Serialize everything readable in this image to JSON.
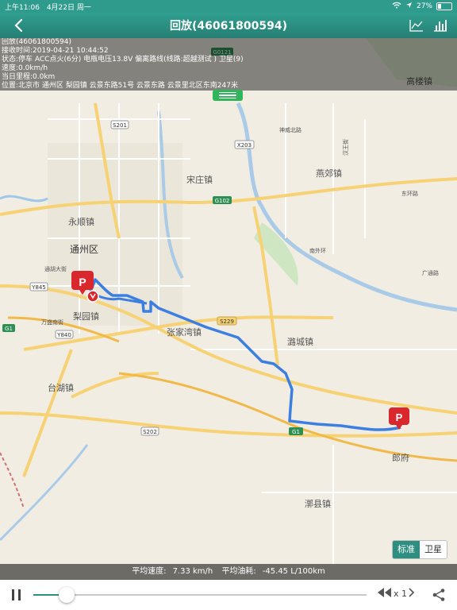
{
  "status_bar": {
    "time": "上午11:06",
    "date": "4月22日 周一",
    "battery": "27%"
  },
  "nav": {
    "title": "回放(46061800594)",
    "icons": [
      "back-chevron-icon",
      "line-chart-icon",
      "bar-chart-icon"
    ]
  },
  "info": {
    "line1": "回放(46061800594)",
    "line2": "接收时间:2019-04-21 10:44:52",
    "line3": "状态:停车  ACC点火(6分) 电瓶电压13.8V 偏离路线(线路:超越测试 ) 卫星(9)",
    "line4": "速度:0.0km/h",
    "line5": "当日里程:0.0km",
    "line6": "位置:北京市 通州区 梨园镇 云景东路51号 云景东路 云景里北区东南247米"
  },
  "map": {
    "labels": {
      "gaolouzhen": "高楼镇",
      "songzhuangzhen": "宋庄镇",
      "yanjiaozhen": "燕郊镇",
      "yongshunzhen": "永顺镇",
      "tongzhouqu": "通州区",
      "liyuanzhen": "梨园镇",
      "zhangjiawanzhen": "张家湾镇",
      "luchengzhen": "潞城镇",
      "taihuzhen": "台湖镇",
      "langfu": "郎府",
      "dazhen": "漷县镇",
      "shenweibeilu": "神威北路",
      "hanwangjie": "汉王街",
      "dongsihuan": "东环路",
      "nanwaihuan": "南外环",
      "tongyunlu": "通胡大街",
      "wanshengnanjie": "万盛南街",
      "guangtonglu": "广通路",
      "s201": "S201",
      "x203": "X203",
      "g102": "G102",
      "y845": "Y845",
      "g1": "G1",
      "y840": "Y840",
      "s229": "S229",
      "s202": "S202",
      "g1b": "G1",
      "g0121": "G0121"
    }
  },
  "map_toggle": {
    "standard": "标准",
    "satellite": "卫星"
  },
  "stats": {
    "avg_speed_label": "平均速度:",
    "avg_speed": "7.33 km/h",
    "avg_fuel_label": "平均油耗:",
    "avg_fuel": "-45.45 L/100km"
  },
  "playback": {
    "speed": "x 1",
    "progress": 0.1
  },
  "colors": {
    "header": "#2a8a7e",
    "route": "#3d7fe0",
    "marker": "#d9272e"
  }
}
